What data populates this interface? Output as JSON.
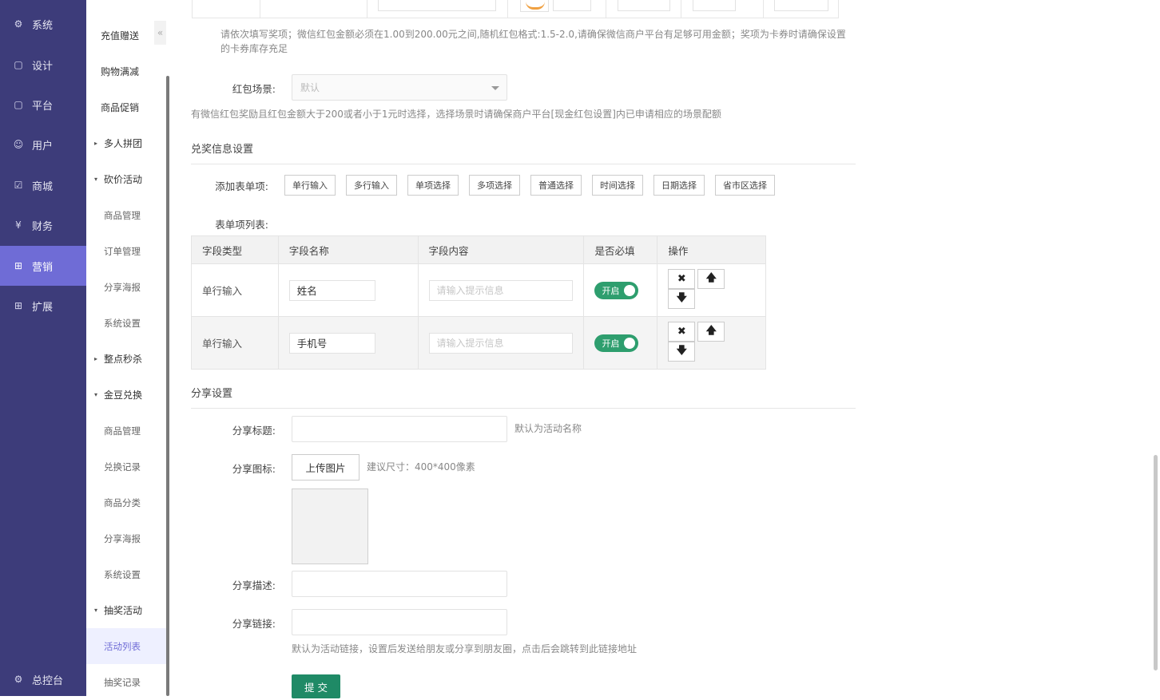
{
  "nav1": {
    "items": [
      {
        "label": "系统",
        "icon": "gear-icon"
      },
      {
        "label": "设计",
        "icon": "monitor-icon"
      },
      {
        "label": "平台",
        "icon": "monitor-icon"
      },
      {
        "label": "用户",
        "icon": "user-icon"
      },
      {
        "label": "商城",
        "icon": "shop-icon"
      },
      {
        "label": "财务",
        "icon": "money-icon"
      },
      {
        "label": "营销",
        "icon": "gift-icon"
      },
      {
        "label": "扩展",
        "icon": "grid-icon"
      }
    ],
    "bottom": {
      "label": "总控台",
      "icon": "gear-icon"
    },
    "active_color": "#6f6cd6",
    "bg_color": "#3d3c7a"
  },
  "nav2": {
    "items": [
      {
        "label": "充值赠送"
      },
      {
        "label": "购物满减"
      },
      {
        "label": "商品促销"
      },
      {
        "label": "多人拼团",
        "caret": "▸"
      },
      {
        "label": "砍价活动",
        "caret": "▾"
      },
      {
        "label": "商品管理"
      },
      {
        "label": "订单管理"
      },
      {
        "label": "分享海报"
      },
      {
        "label": "系统设置"
      },
      {
        "label": "整点秒杀",
        "caret": "▸"
      },
      {
        "label": "金豆兑换",
        "caret": "▾"
      },
      {
        "label": "商品管理"
      },
      {
        "label": "兑换记录"
      },
      {
        "label": "商品分类"
      },
      {
        "label": "分享海报"
      },
      {
        "label": "系统设置"
      },
      {
        "label": "抽奖活动",
        "caret": "▾"
      },
      {
        "label": "活动列表"
      },
      {
        "label": "抽奖记录"
      }
    ],
    "collapse_glyph": "«"
  },
  "prize": {
    "help": "请依次填写奖项；微信红包金额必须在1.00到200.00元之间,随机红包格式:1.5-2.0,请确保微信商户平台有足够可用金额；奖项为卡券时请确保设置的卡券库存充足",
    "scene_label": "红包场景:",
    "scene_value": "默认",
    "scene_help": "有微信红包奖励且红包金额大于200或者小于1元时选择，选择场景时请确保商户平台[现金红包设置]内已申请相应的场景配额"
  },
  "redeem": {
    "title": "兑奖信息设置",
    "add_label": "添加表单项:",
    "buttons": [
      "单行输入",
      "多行输入",
      "单项选择",
      "多项选择",
      "普通选择",
      "时间选择",
      "日期选择",
      "省市区选择"
    ],
    "list_label": "表单项列表:",
    "columns": [
      "字段类型",
      "字段名称",
      "字段内容",
      "是否必填",
      "操作"
    ],
    "rows": [
      {
        "type": "单行输入",
        "name": "姓名",
        "placeholder": "请输入提示信息",
        "required": "开启"
      },
      {
        "type": "单行输入",
        "name": "手机号",
        "placeholder": "请输入提示信息",
        "required": "开启"
      }
    ],
    "ops": {
      "delete": "✖",
      "up": "🡅",
      "down": "🡇"
    },
    "toggle_color": "#2e9e6e"
  },
  "share": {
    "title": "分享设置",
    "title_label": "分享标题:",
    "title_value": "",
    "title_help": "默认为活动名称",
    "icon_label": "分享图标:",
    "upload_label": "上传图片",
    "icon_help": "建议尺寸：400*400像素",
    "desc_label": "分享描述:",
    "desc_value": "",
    "link_label": "分享链接:",
    "link_value": "",
    "link_help": "默认为活动链接，设置后发送给朋友或分享到朋友圈，点击后会跳转到此链接地址"
  },
  "submit_label": "提 交"
}
